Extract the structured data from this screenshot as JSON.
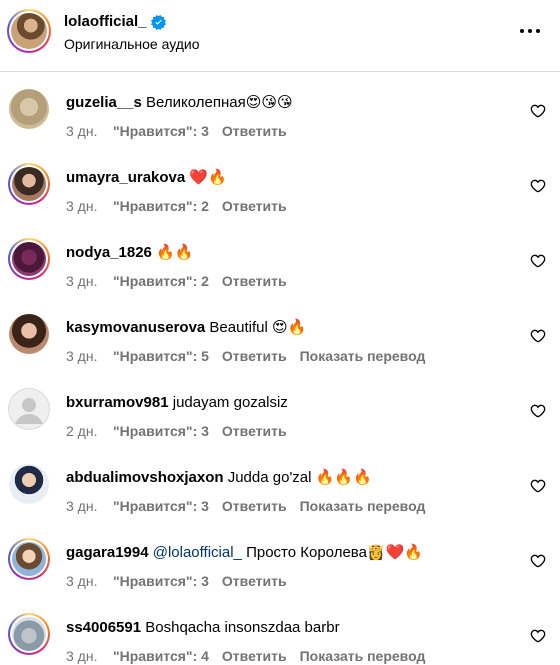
{
  "header": {
    "username": "lolaofficial_",
    "verified": true,
    "audio_label": "Оригинальное аудио"
  },
  "meta_labels": {
    "likes_prefix": "\"Нравится\": ",
    "reply": "Ответить",
    "translate": "Показать перевод"
  },
  "comments": [
    {
      "username": "guzelia__s",
      "text": "Великолепная😍😘😘",
      "time": "3 дн.",
      "likes": "\"Нравится\": 3",
      "reply": "Ответить",
      "translate": ""
    },
    {
      "username": "umayra_urakova",
      "text": "❤️🔥",
      "time": "3 дн.",
      "likes": "\"Нравится\": 2",
      "reply": "Ответить",
      "translate": ""
    },
    {
      "username": "nodya_1826",
      "text": "🔥🔥",
      "time": "3 дн.",
      "likes": "\"Нравится\": 2",
      "reply": "Ответить",
      "translate": ""
    },
    {
      "username": "kasymovanuserova",
      "text": "Beautiful 😍🔥",
      "time": "3 дн.",
      "likes": "\"Нравится\": 5",
      "reply": "Ответить",
      "translate": "Показать перевод"
    },
    {
      "username": "bxurramov981",
      "text": "judayam gozalsiz",
      "time": "2 дн.",
      "likes": "\"Нравится\": 3",
      "reply": "Ответить",
      "translate": ""
    },
    {
      "username": "abdualimovshoxjaxon",
      "text": "Judda go'zal 🔥🔥🔥",
      "time": "3 дн.",
      "likes": "\"Нравится\": 3",
      "reply": "Ответить",
      "translate": "Показать перевод"
    },
    {
      "username": "gagara1994",
      "mention": "@lolaofficial_",
      "text": "Просто Королева👸❤️🔥",
      "time": "3 дн.",
      "likes": "\"Нравится\": 3",
      "reply": "Ответить",
      "translate": ""
    },
    {
      "username": "ss4006591",
      "text": "Boshqacha insonszdaa barbr",
      "time": "3 дн.",
      "likes": "\"Нравится\": 4",
      "reply": "Ответить",
      "translate": "Показать перевод"
    }
  ],
  "colors": {
    "meta_gray": "#737373",
    "mention_blue": "#00376b",
    "verified_blue": "#0095f6",
    "divider": "#dbdbdb"
  },
  "icons": {
    "verified": "verified-badge-icon",
    "more": "more-horizontal-icon",
    "like": "heart-outline-icon",
    "default_avatar": "default-avatar-icon"
  }
}
